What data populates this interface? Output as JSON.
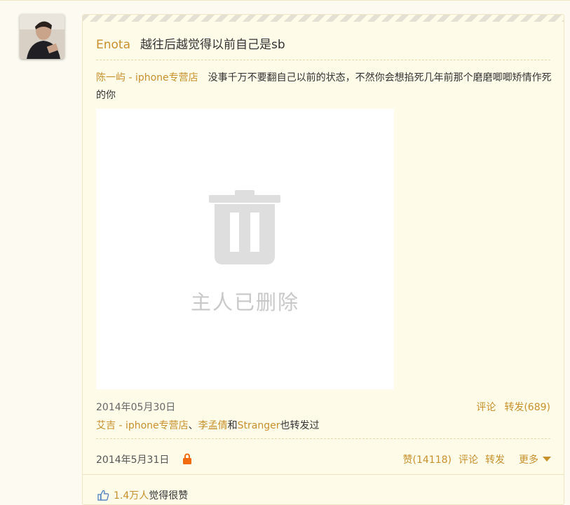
{
  "feed": {
    "author": "Enota",
    "text": "越往后越觉得以前自己是sb"
  },
  "original": {
    "author": "陈一屿 - iphone专营店",
    "text": "没事千万不要翻自己以前的状态，不然你会想掐死几年前那个磨磨唧唧矫情作死的你",
    "deleted_notice": "主人已删除",
    "date": "2014年05月30日",
    "comment_label": "评论",
    "repost_label": "转发(689)",
    "forwarders": {
      "user1": "艾吉 - iphone专营店",
      "sep1": "、",
      "user2": "李孟倩",
      "sep2": "和",
      "user3": "Stranger",
      "suffix": "也转发过"
    }
  },
  "post": {
    "date": "2014年5月31日",
    "like_label": "赞(14118)",
    "comment_label": "评论",
    "repost_label": "转发",
    "more_label": "更多"
  },
  "likes": {
    "count": "1.4万人",
    "suffix": "觉得很赞"
  },
  "colors": {
    "link": "#c8902a",
    "background": "#fdfbf1",
    "lock": "#f26b0f"
  },
  "icons": [
    "avatar",
    "trash-icon",
    "lock-icon",
    "chevron-down-icon",
    "thumbs-up-icon"
  ]
}
